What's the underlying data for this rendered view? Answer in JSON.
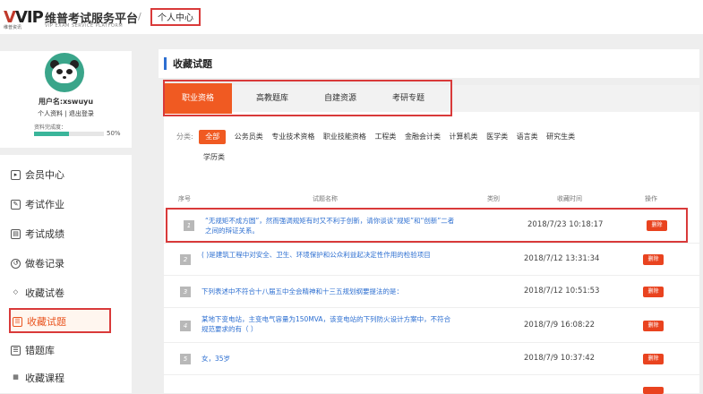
{
  "header": {
    "logo_mark": "VIP",
    "logo_small": "维普资讯",
    "logo_cn": "维普考试服务平台",
    "logo_en": "VIP EXAM SERVICE PLATFORM",
    "separator": "/",
    "breadcrumb": "个人中心"
  },
  "profile": {
    "username": "用户名:xswuyu",
    "link_profile": "个人资料",
    "link_divider": "|",
    "link_logout": "退出登录",
    "completion_label": "资料完成度：",
    "completion_percent": "50%",
    "completion_value": 0.5
  },
  "menu": {
    "items": [
      {
        "label": "会员中心",
        "icon": "member-icon"
      },
      {
        "label": "考试作业",
        "icon": "homework-icon"
      },
      {
        "label": "考试成绩",
        "icon": "score-icon"
      },
      {
        "label": "做卷记录",
        "icon": "history-icon"
      },
      {
        "label": "收藏试卷",
        "icon": "paper-favorite-icon"
      },
      {
        "label": "收藏试题",
        "icon": "question-favorite-icon",
        "active": true
      },
      {
        "label": "错题库",
        "icon": "wrong-question-icon"
      },
      {
        "label": "收藏课程",
        "icon": "course-icon"
      }
    ]
  },
  "main": {
    "title": "收藏试题",
    "tabs": [
      "职业资格",
      "高教题库",
      "自建资源",
      "考研专题"
    ],
    "category_label": "分类:",
    "categories": [
      "全部",
      "公务员类",
      "专业技术资格",
      "职业技能资格",
      "工程类",
      "金融会计类",
      "计算机类",
      "医学类",
      "语言类",
      "研究生类",
      "学历类"
    ],
    "table": {
      "columns": [
        "序号",
        "试题名称",
        "类别",
        "收藏时间",
        "操作"
      ],
      "rows": [
        {
          "index": "1",
          "question": "“无规矩不成方圆”，然而强调规矩有时又不利于创新，请你谈谈“规矩”和“创新”二者之间的辩证关系。",
          "time": "2018/7/23 10:18:17",
          "action": "删除"
        },
        {
          "index": "2",
          "question": "( )是建筑工程中对安全、卫生、环境保护和公众利益起决定性作用的检验项目",
          "time": "2018/7/12 13:31:34",
          "action": "删除"
        },
        {
          "index": "3",
          "question": "下列表述中不符合十八届五中全会精神和十三五规划纲要提法的是：",
          "time": "2018/7/12 10:51:53",
          "action": "删除"
        },
        {
          "index": "4",
          "question": "某地下变电站，主变电气容量为150MVA，该变电站的下列防火设计方案中，不符合规范要求的有（ ）",
          "time": "2018/7/9 16:08:22",
          "action": "删除"
        },
        {
          "index": "5",
          "question": "女，35岁",
          "time": "2018/7/9 10:37:42",
          "action": "删除"
        }
      ]
    }
  },
  "colors": {
    "accent_orange": "#f05a22",
    "highlight_red": "#d93a3a",
    "link_blue": "#2d6fd1",
    "progress_green": "#3ab59a"
  }
}
